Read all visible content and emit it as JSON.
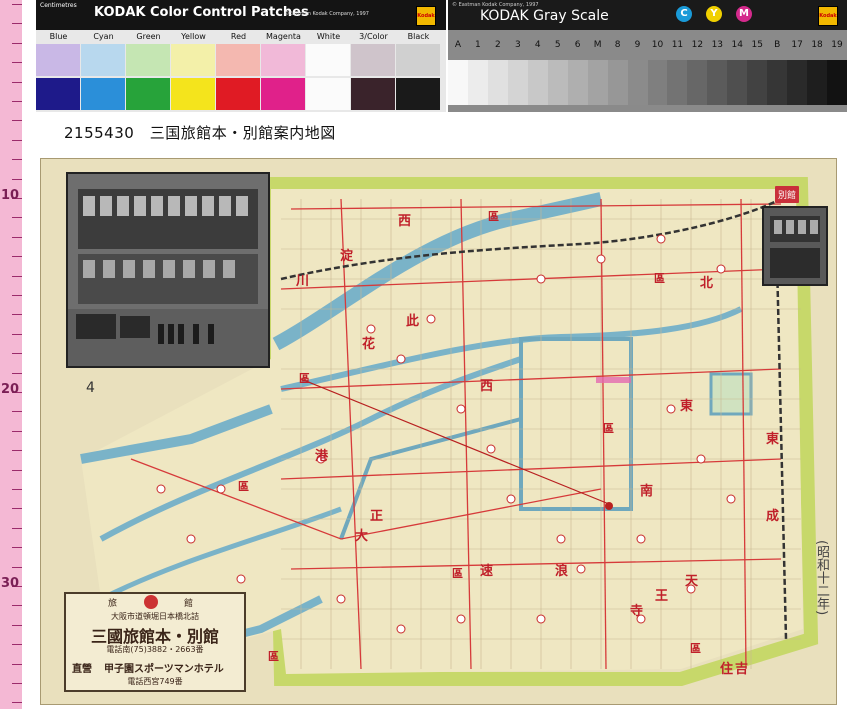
{
  "color_strip": {
    "unit_label": "Centimetres",
    "title": "KODAK Color Control Patches",
    "copyright": "©Eastman Kodak Company, 1997",
    "logo": "Kodak",
    "patches": [
      {
        "label": "Blue",
        "top": "#c9b8e6",
        "bottom": "#1e1a8a"
      },
      {
        "label": "Cyan",
        "top": "#b8d8ee",
        "bottom": "#2b8fd9"
      },
      {
        "label": "Green",
        "top": "#c5e6b3",
        "bottom": "#27a33a"
      },
      {
        "label": "Yellow",
        "top": "#f3f0a9",
        "bottom": "#f4e41c"
      },
      {
        "label": "Red",
        "top": "#f4b8b0",
        "bottom": "#e01b24"
      },
      {
        "label": "Magenta",
        "top": "#f1b9d8",
        "bottom": "#e0218a"
      },
      {
        "label": "White",
        "top": "#fbfbfb",
        "bottom": "#fbfbfb"
      },
      {
        "label": "3/Color",
        "top": "#cfc4cb",
        "bottom": "#3a232b"
      },
      {
        "label": "Black",
        "top": "#d0d0d0",
        "bottom": "#1a1a1a"
      }
    ]
  },
  "gray_strip": {
    "copyright": "© Eastman Kodak Company, 1997",
    "title": "KODAK Gray Scale",
    "cmy": [
      {
        "letter": "C",
        "color": "#1a9ad8"
      },
      {
        "letter": "Y",
        "color": "#f0d000"
      },
      {
        "letter": "M",
        "color": "#d42a8c"
      }
    ],
    "logo": "Kodak",
    "steps": [
      "A",
      "1",
      "2",
      "3",
      "4",
      "5",
      "6",
      "M",
      "8",
      "9",
      "10",
      "11",
      "12",
      "13",
      "14",
      "15",
      "B",
      "17",
      "18",
      "19"
    ]
  },
  "ruler": {
    "big_numbers": [
      "10",
      "20",
      "30"
    ]
  },
  "caption": "2155430　三国旅館本・別館案内地図",
  "map": {
    "district_labels": [
      "西",
      "淀",
      "川",
      "此",
      "花",
      "西",
      "東",
      "北",
      "港",
      "南",
      "浪",
      "速",
      "天",
      "王",
      "寺",
      "東",
      "成",
      "住",
      "吉",
      "大",
      "正",
      "區",
      "區",
      "區",
      "區",
      "區",
      "區",
      "區",
      "區"
    ],
    "info_box": {
      "top_left": "旅",
      "top_right": "館",
      "address": "大阪市道頓堀日本橋北詰",
      "name": "三國旅館本・別館",
      "phone": "電話南(75)3882・2663番",
      "direct_label": "直營",
      "hotel": "甲子園スポーツマンホテル",
      "hotel_phone": "電話西宮749番"
    },
    "side_note": "(昭和十二年)",
    "corner_badge": "別館",
    "map_number": "4"
  }
}
